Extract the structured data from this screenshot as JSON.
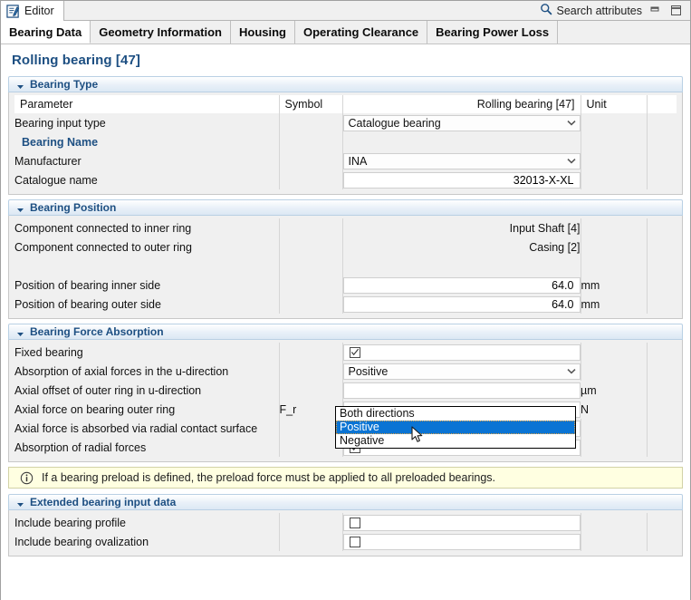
{
  "window": {
    "view_tab_label": "Editor",
    "view_tab_icon": "editor-icon",
    "search_placeholder": "Search attributes",
    "search_icon": "search-icon",
    "minimize_label": "Minimize",
    "maximize_label": "Maximize"
  },
  "tabs": [
    {
      "label": "Bearing Data",
      "active": true
    },
    {
      "label": "Geometry Information",
      "active": false
    },
    {
      "label": "Housing",
      "active": false
    },
    {
      "label": "Operating Clearance",
      "active": false
    },
    {
      "label": "Bearing Power Loss",
      "active": false
    }
  ],
  "page": {
    "title": "Rolling bearing [47]"
  },
  "columns": {
    "parameter": "Parameter",
    "symbol": "Symbol",
    "value": "Rolling bearing [47]",
    "unit": "Unit"
  },
  "sections": {
    "bearing_type": {
      "title": "Bearing Type",
      "expanded": true,
      "rows": [
        {
          "kind": "combo",
          "label": "Bearing input type",
          "symbol": "",
          "value": "Catalogue bearing",
          "unit": ""
        },
        {
          "kind": "group",
          "label": "Bearing Name"
        },
        {
          "kind": "combo",
          "label": "Manufacturer",
          "symbol": "",
          "value": "INA",
          "unit": ""
        },
        {
          "kind": "text",
          "label": "Catalogue name",
          "symbol": "",
          "value": "32013-X-XL",
          "unit": ""
        }
      ]
    },
    "bearing_position": {
      "title": "Bearing Position",
      "expanded": true,
      "rows": [
        {
          "kind": "readonly",
          "label": "Component connected to inner ring",
          "symbol": "",
          "value": "Input Shaft [4]",
          "unit": ""
        },
        {
          "kind": "readonly",
          "label": "Component connected to outer ring",
          "symbol": "",
          "value": "Casing [2]",
          "unit": ""
        },
        {
          "kind": "spacer",
          "label": "",
          "symbol": "",
          "value": "",
          "unit": ""
        },
        {
          "kind": "text",
          "label": "Position of bearing inner side",
          "symbol": "",
          "value": "64.0",
          "unit": "mm"
        },
        {
          "kind": "text",
          "label": "Position of bearing outer side",
          "symbol": "",
          "value": "64.0",
          "unit": "mm"
        }
      ]
    },
    "force_absorption": {
      "title": "Bearing Force Absorption",
      "expanded": true,
      "rows": [
        {
          "kind": "checkbox",
          "label": "Fixed bearing",
          "symbol": "",
          "checked": true,
          "unit": ""
        },
        {
          "kind": "combo",
          "label": "Absorption of axial forces in the u-direction",
          "symbol": "",
          "value": "Positive",
          "unit": ""
        },
        {
          "kind": "text",
          "label": "Axial offset of outer ring in u-direction",
          "symbol": "",
          "value": "",
          "unit": "µm"
        },
        {
          "kind": "text",
          "label": "Axial force on bearing outer ring",
          "symbol": "F_r",
          "value": "",
          "unit": "N"
        },
        {
          "kind": "checkbox",
          "label": "Axial force is absorbed via radial contact surface",
          "symbol": "",
          "checked": false,
          "unit": ""
        },
        {
          "kind": "checkbox",
          "label": "Absorption of radial forces",
          "symbol": "",
          "checked": true,
          "unit": ""
        }
      ]
    },
    "extended": {
      "title": "Extended bearing input data",
      "expanded": true,
      "rows": [
        {
          "kind": "checkbox",
          "label": "Include bearing profile",
          "symbol": "",
          "checked": false,
          "unit": ""
        },
        {
          "kind": "checkbox",
          "label": "Include bearing ovalization",
          "symbol": "",
          "checked": false,
          "unit": ""
        }
      ]
    }
  },
  "dropdown": {
    "open": true,
    "options": [
      "Both directions",
      "Positive",
      "Negative"
    ],
    "selected": "Positive",
    "selected_index": 1
  },
  "info": {
    "icon": "info-icon",
    "message": "If a bearing preload is defined, the preload force must be applied to all preloaded bearings."
  },
  "colors": {
    "accent_blue": "#1d4f82",
    "selection_blue": "#0a74d4",
    "info_bg": "#ffffe1",
    "panel_bg": "#f0f0f0"
  }
}
